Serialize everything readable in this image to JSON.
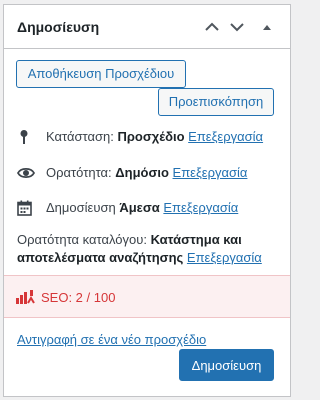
{
  "header": {
    "title": "Δημοσίευση"
  },
  "buttons": {
    "save_draft": "Αποθήκευση Προσχέδιου",
    "preview": "Προεπισκόπηση",
    "publish": "Δημοσίευση"
  },
  "status": {
    "label": "Κατάσταση:",
    "value": "Προσχέδιο",
    "edit": "Επεξεργασία"
  },
  "visibility": {
    "label": "Ορατότητα:",
    "value": "Δημόσιο",
    "edit": "Επεξεργασία"
  },
  "publish_time": {
    "label": "Δημοσίευση",
    "value": "Άμεσα",
    "edit": "Επεξεργασία"
  },
  "catalog": {
    "label": "Ορατότητα καταλόγου:",
    "value": "Κατάστημα και αποτελέσματα αναζήτησης",
    "edit": "Επεξεργασία"
  },
  "seo": {
    "text": "SEO: 2 / 100"
  },
  "copy_link": "Αντιγραφή σε ένα νέο προσχέδιο",
  "colors": {
    "accent": "#2271b1",
    "seo_bad": "#d63638",
    "seo_bg": "#fcf0f1"
  },
  "icons": [
    "chevron-up-icon",
    "chevron-down-icon",
    "caret-up-icon",
    "pin-icon",
    "eye-icon",
    "calendar-icon",
    "seo-score-icon"
  ]
}
